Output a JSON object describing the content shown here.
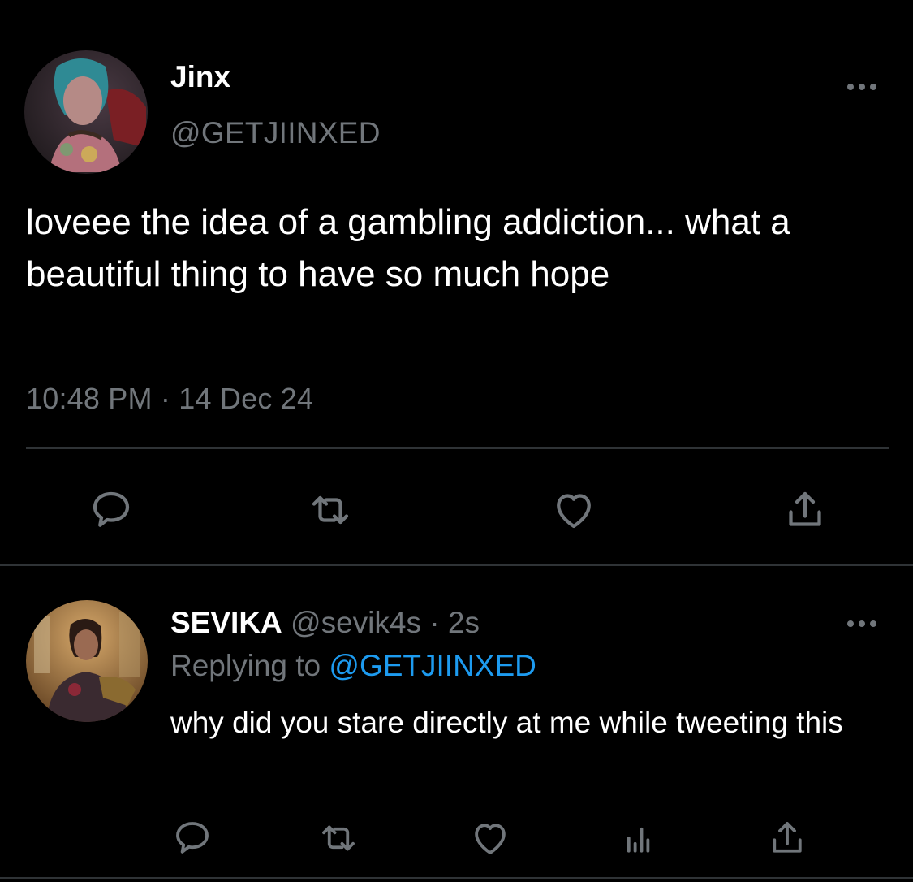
{
  "main_tweet": {
    "author_name": "Jinx",
    "author_handle": "@GETJIINXED",
    "text": "loveee the idea of a gambling addiction... what a beautiful thing to have so much hope",
    "timestamp": "10:48 PM · 14 Dec 24",
    "more_icon": "more-horizontal-icon",
    "actions": [
      "reply-icon",
      "retweet-icon",
      "like-icon",
      "share-icon"
    ]
  },
  "reply_tweet": {
    "author_name": "SEVIKA",
    "author_handle": "@sevik4s",
    "separator": "·",
    "age": "2s",
    "replying_prefix": "Replying to",
    "replying_to": "@GETJIINXED",
    "text": "why did you stare directly at me while tweeting this",
    "more_icon": "more-horizontal-icon",
    "actions": [
      "reply-icon",
      "retweet-icon",
      "like-icon",
      "analytics-icon",
      "share-icon"
    ]
  },
  "colors": {
    "background": "#000000",
    "text_primary": "#ffffff",
    "text_secondary": "#71767b",
    "link": "#1d9bf0",
    "divider": "#2f3336"
  }
}
